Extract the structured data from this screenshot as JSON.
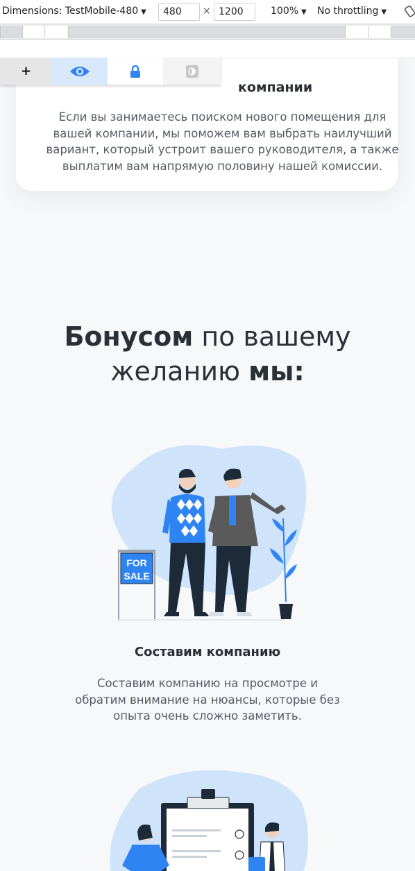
{
  "devtools": {
    "dimensions_label": "Dimensions: TestMobile-480",
    "width_value": "480",
    "times": "×",
    "height_value": "1200",
    "zoom": "100%",
    "throttling": "No throttling"
  },
  "a11y_widget": {
    "buttons": [
      {
        "icon": "plus-icon",
        "label": "+"
      },
      {
        "icon": "eye-icon"
      },
      {
        "icon": "lock-icon"
      },
      {
        "icon": "contrast-icon"
      }
    ]
  },
  "card": {
    "title_fragment": "компании",
    "text": "Если вы занимаетесь поиском нового помещения для вашей компании, мы поможем вам выбрать наилучший вариант, который устроит вашего руководителя, а также выплатим вам напрямую половину нашей комиссии."
  },
  "bonus": {
    "strong1": "Бонусом",
    "normal1": " по вашему",
    "normal2": "желанию ",
    "strong2": "мы:"
  },
  "features": [
    {
      "sign_line1": "FOR",
      "sign_line2": "SALE",
      "title": "Составим компанию",
      "text": "Составим компанию на просмотре и обратим внимание на нюансы, которые без опыта очень сложно заметить."
    }
  ],
  "colors": {
    "accent": "#2f84f4",
    "blob": "#cfe3fb",
    "dark": "#2b3036"
  }
}
